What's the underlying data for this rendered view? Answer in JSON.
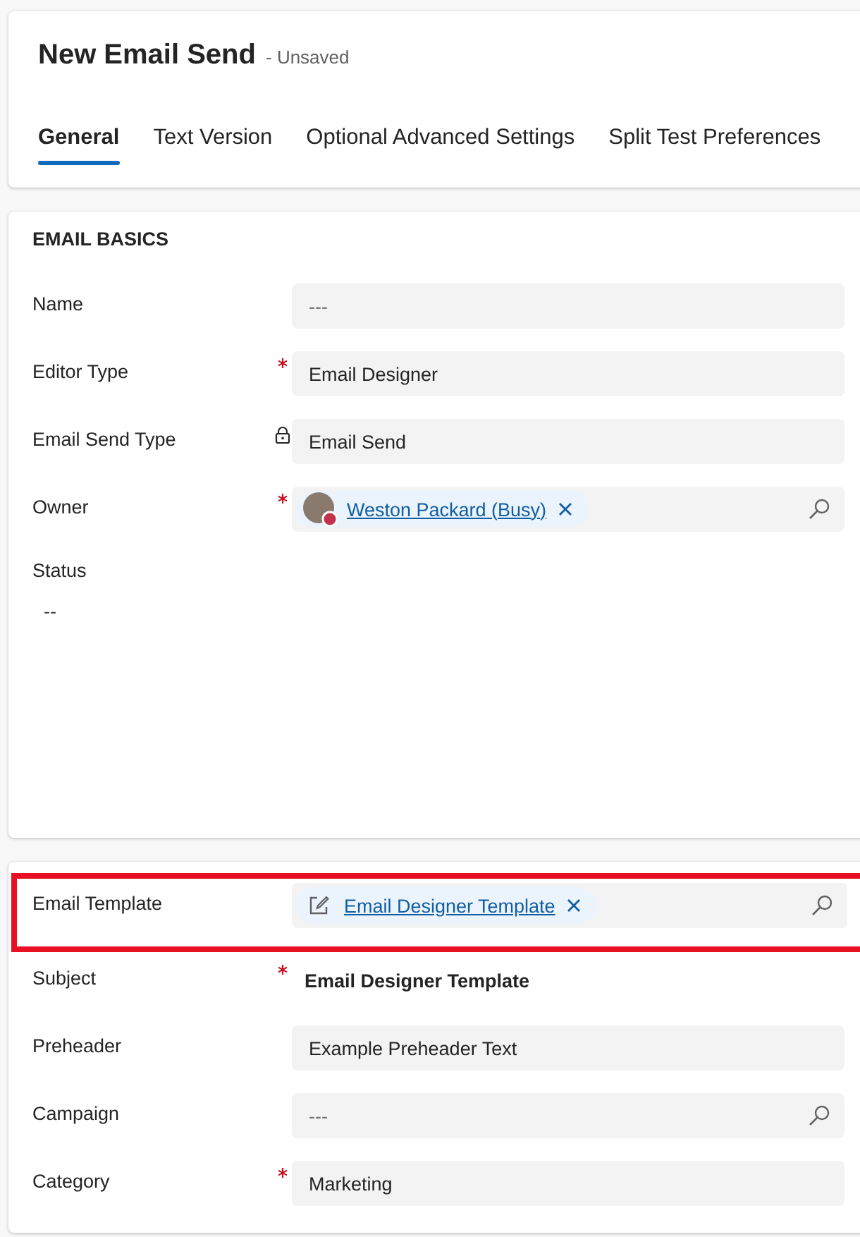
{
  "header": {
    "title": "New Email Send",
    "subtitle": "- Unsaved"
  },
  "tabs": [
    {
      "label": "General",
      "selected": true
    },
    {
      "label": "Text Version",
      "selected": false
    },
    {
      "label": "Optional Advanced Settings",
      "selected": false
    },
    {
      "label": "Split Test Preferences",
      "selected": false
    }
  ],
  "sections": [
    {
      "title": "EMAIL BASICS",
      "fields": [
        {
          "kind": "input",
          "label": "Name",
          "required": false,
          "locked": false,
          "placeholder": "---"
        },
        {
          "kind": "input",
          "label": "Editor Type",
          "required": true,
          "locked": false,
          "value": "Email Designer"
        },
        {
          "kind": "input",
          "label": "Email Send Type",
          "required": false,
          "locked": true,
          "value": "Email Send"
        },
        {
          "kind": "lookup",
          "label": "Owner",
          "required": true,
          "locked": false,
          "tag": {
            "kind": "person",
            "text": "Weston Packard (Busy)"
          }
        },
        {
          "kind": "stacked",
          "label": "Status",
          "required": false,
          "locked": false,
          "value": "--"
        }
      ]
    },
    {
      "fields": [
        {
          "kind": "lookup",
          "label": "Email Template",
          "required": false,
          "locked": false,
          "highlighted": true,
          "tag": {
            "kind": "record",
            "text": "Email Designer Template"
          }
        },
        {
          "kind": "bold",
          "label": "Subject",
          "required": true,
          "locked": false,
          "value": "Email Designer Template"
        },
        {
          "kind": "input",
          "label": "Preheader",
          "required": false,
          "locked": false,
          "value": "Example Preheader Text"
        },
        {
          "kind": "lookup",
          "label": "Campaign",
          "required": false,
          "locked": false,
          "placeholder": "---"
        },
        {
          "kind": "input",
          "label": "Category",
          "required": true,
          "locked": false,
          "value": "Marketing"
        }
      ]
    }
  ]
}
